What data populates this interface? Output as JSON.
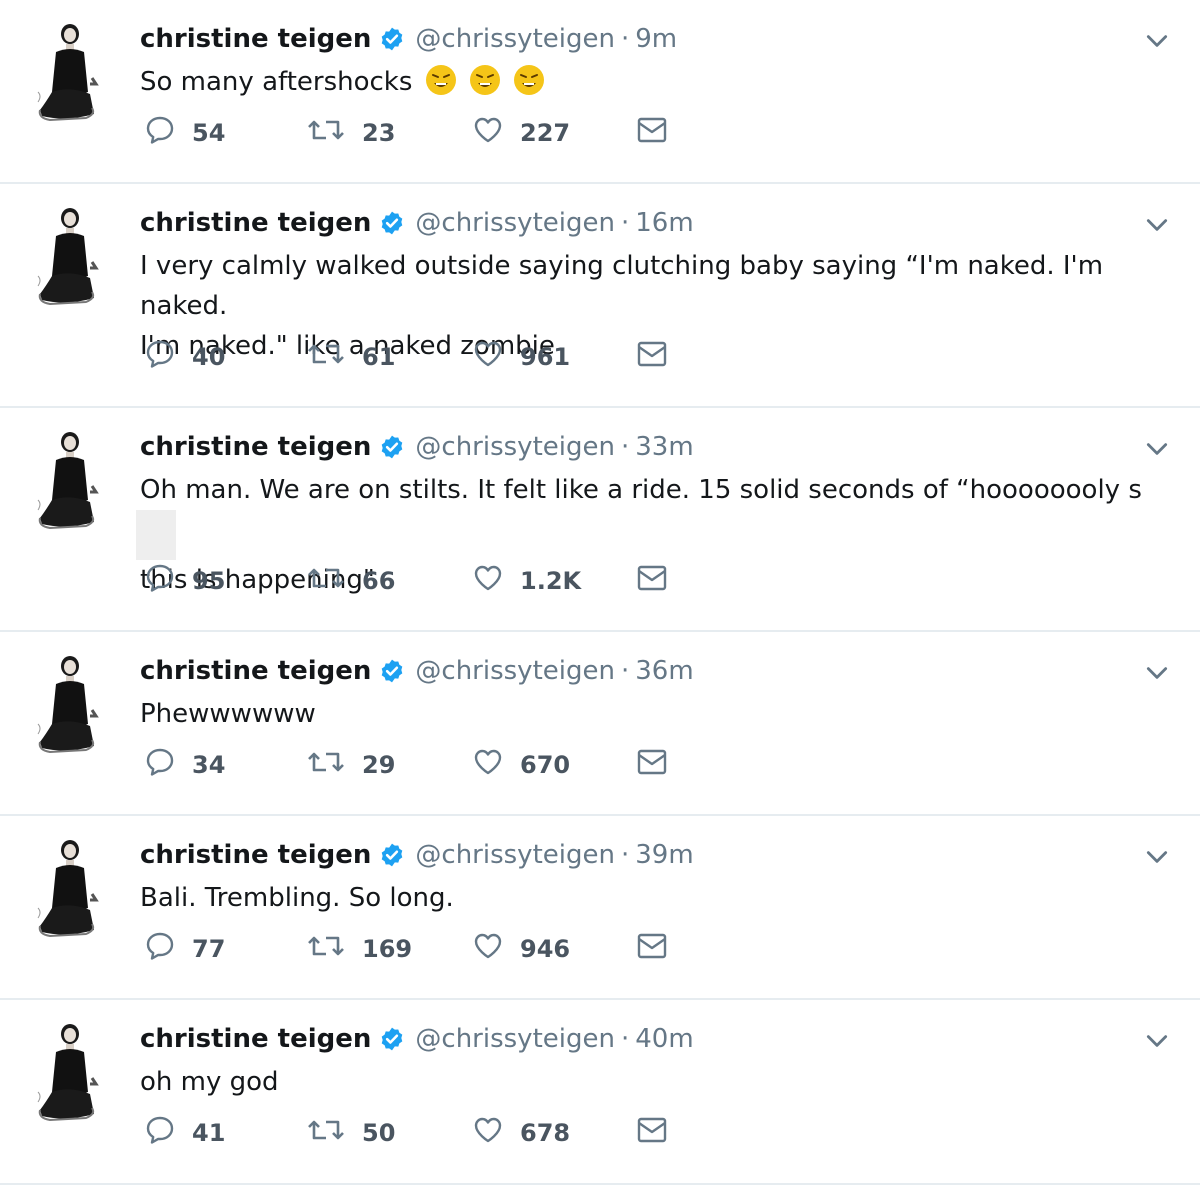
{
  "tweets": [
    {
      "name": "christine teigen",
      "handle": "@chrissyteigen",
      "time": "9m",
      "text_lines": [
        "So many aftershocks"
      ],
      "emoji_count": 3,
      "replies": "54",
      "retweets": "23",
      "likes": "227"
    },
    {
      "name": "christine teigen",
      "handle": "@chrissyteigen",
      "time": "16m",
      "text_lines": [
        "I very calmly walked outside saying clutching baby saying “I'm naked. I'm naked.",
        "I'm naked.\" like a naked zombie"
      ],
      "replies": "40",
      "retweets": "61",
      "likes": "961"
    },
    {
      "name": "christine teigen",
      "handle": "@chrissyteigen",
      "time": "33m",
      "text_lines": [
        "Oh man. We are on stilts. It felt like a ride. 15 solid seconds of “hoooooooly s",
        "this is happening\""
      ],
      "redacted": true,
      "replies": "95",
      "retweets": "66",
      "likes": "1.2K"
    },
    {
      "name": "christine teigen",
      "handle": "@chrissyteigen",
      "time": "36m",
      "text_lines": [
        "Phewwwwww"
      ],
      "replies": "34",
      "retweets": "29",
      "likes": "670"
    },
    {
      "name": "christine teigen",
      "handle": "@chrissyteigen",
      "time": "39m",
      "text_lines": [
        "Bali. Trembling. So long."
      ],
      "replies": "77",
      "retweets": "169",
      "likes": "946"
    },
    {
      "name": "christine teigen",
      "handle": "@chrissyteigen",
      "time": "40m",
      "text_lines": [
        "oh my god"
      ],
      "replies": "41",
      "retweets": "50",
      "likes": "678"
    }
  ],
  "colors": {
    "verified": "#1da1f2",
    "muted": "#657786",
    "text": "#14171a",
    "divider": "#e6ecf0",
    "emoji": "#f5c518"
  },
  "icons": {
    "verified": "verified-badge-icon",
    "caret": "chevron-down-icon",
    "reply": "reply-icon",
    "retweet": "retweet-icon",
    "like": "heart-icon",
    "dm": "envelope-icon",
    "emoji": "weary-face-emoji-icon"
  }
}
